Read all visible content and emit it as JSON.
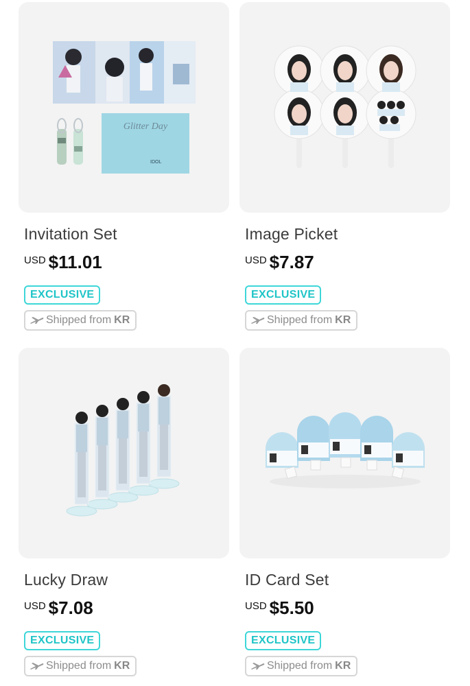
{
  "products": [
    {
      "name": "Invitation Set",
      "currency": "USD",
      "price": "$11.01",
      "badge": "EXCLUSIVE",
      "shipping": {
        "prefix": "Shipped from",
        "origin": "KR"
      }
    },
    {
      "name": "Image Picket",
      "currency": "USD",
      "price": "$7.87",
      "badge": "EXCLUSIVE",
      "shipping": {
        "prefix": "Shipped from",
        "origin": "KR"
      }
    },
    {
      "name": "Lucky Draw",
      "currency": "USD",
      "price": "$7.08",
      "badge": "EXCLUSIVE",
      "shipping": {
        "prefix": "Shipped from",
        "origin": "KR"
      }
    },
    {
      "name": "ID Card Set",
      "currency": "USD",
      "price": "$5.50",
      "badge": "EXCLUSIVE",
      "shipping": {
        "prefix": "Shipped from",
        "origin": "KR"
      }
    }
  ],
  "images": {
    "invitation_card_text": "Glitter Day"
  },
  "colors": {
    "accent": "#3dd6d8",
    "card_bg": "#f3f3f3",
    "ship_border": "#d6d6d6"
  }
}
